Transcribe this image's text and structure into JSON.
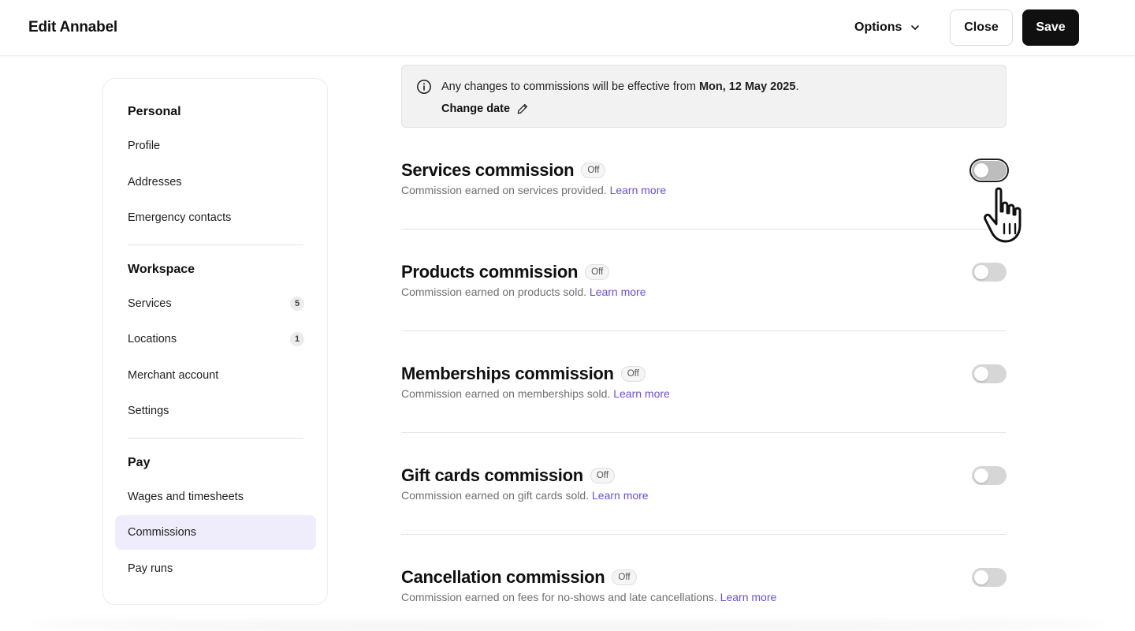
{
  "header": {
    "title": "Edit Annabel",
    "options_label": "Options",
    "close_label": "Close",
    "save_label": "Save"
  },
  "sidebar": {
    "sections": [
      {
        "title": "Personal",
        "items": [
          {
            "label": "Profile"
          },
          {
            "label": "Addresses"
          },
          {
            "label": "Emergency contacts"
          }
        ]
      },
      {
        "title": "Workspace",
        "items": [
          {
            "label": "Services",
            "count": "5"
          },
          {
            "label": "Locations",
            "count": "1"
          },
          {
            "label": "Merchant account"
          },
          {
            "label": "Settings"
          }
        ]
      },
      {
        "title": "Pay",
        "items": [
          {
            "label": "Wages and timesheets"
          },
          {
            "label": "Commissions",
            "active": true
          },
          {
            "label": "Pay runs"
          }
        ]
      }
    ]
  },
  "banner": {
    "message_prefix": "Any changes to commissions will be effective from ",
    "effective_date": "Mon, 12 May 2025",
    "message_suffix": ".",
    "change_date_label": "Change date"
  },
  "commissions": [
    {
      "name": "Services commission",
      "status": "Off",
      "description": "Commission earned on services provided.",
      "link": "Learn more",
      "enabled": false
    },
    {
      "name": "Products commission",
      "status": "Off",
      "description": "Commission earned on products sold.",
      "link": "Learn more",
      "enabled": false
    },
    {
      "name": "Memberships commission",
      "status": "Off",
      "description": "Commission earned on memberships sold.",
      "link": "Learn more",
      "enabled": false
    },
    {
      "name": "Gift cards commission",
      "status": "Off",
      "description": "Commission earned on gift cards sold.",
      "link": "Learn more",
      "enabled": false
    },
    {
      "name": "Cancellation commission",
      "status": "Off",
      "description": "Commission earned on fees for no-shows and late cancellations.",
      "link": "Learn more",
      "enabled": false
    }
  ],
  "colors": {
    "accent_link": "#6b4fd8",
    "active_nav_bg": "#efedfb",
    "primary_button": "#101010"
  }
}
